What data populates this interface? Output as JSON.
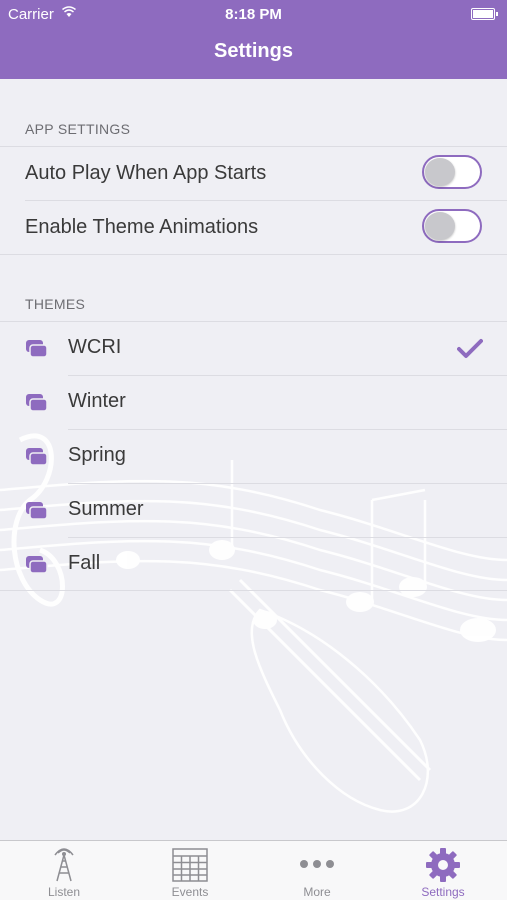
{
  "status_bar": {
    "carrier": "Carrier",
    "time": "8:18 PM"
  },
  "nav": {
    "title": "Settings"
  },
  "app_settings": {
    "header": "APP SETTINGS",
    "rows": [
      {
        "label": "Auto Play When App Starts",
        "enabled": false
      },
      {
        "label": "Enable Theme Animations",
        "enabled": false
      }
    ]
  },
  "themes": {
    "header": "THEMES",
    "items": [
      {
        "label": "WCRI",
        "selected": true
      },
      {
        "label": "Winter",
        "selected": false
      },
      {
        "label": "Spring",
        "selected": false
      },
      {
        "label": "Summer",
        "selected": false
      },
      {
        "label": "Fall",
        "selected": false
      }
    ]
  },
  "tabs": [
    {
      "label": "Listen",
      "icon": "radio-tower-icon",
      "active": false
    },
    {
      "label": "Events",
      "icon": "calendar-grid-icon",
      "active": false
    },
    {
      "label": "More",
      "icon": "more-dots-icon",
      "active": false
    },
    {
      "label": "Settings",
      "icon": "gear-icon",
      "active": true
    }
  ],
  "colors": {
    "accent": "#8e6bbf",
    "background": "#efeff4"
  }
}
